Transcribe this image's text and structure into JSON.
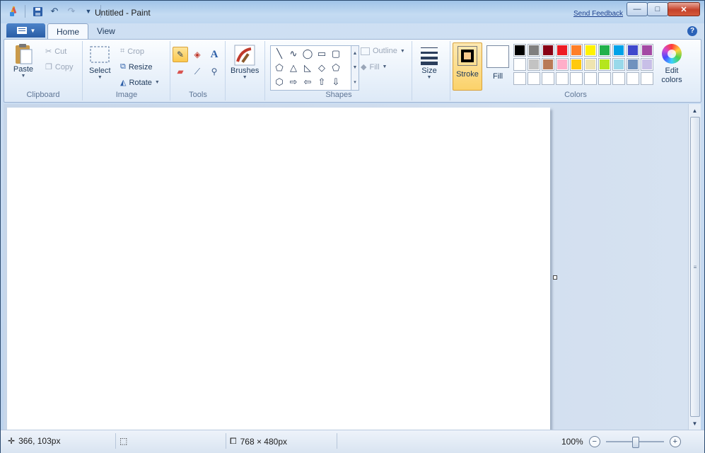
{
  "window": {
    "title": "Untitled - Paint",
    "feedback_link": "Send Feedback",
    "minimize_glyph": "—",
    "maximize_glyph": "□",
    "close_glyph": "✕"
  },
  "tabs": [
    {
      "label": "Home",
      "active": true
    },
    {
      "label": "View",
      "active": false
    }
  ],
  "help_glyph": "?",
  "ribbon": {
    "clipboard": {
      "group_label": "Clipboard",
      "paste": "Paste",
      "cut": "Cut",
      "copy": "Copy"
    },
    "image": {
      "group_label": "Image",
      "select": "Select",
      "crop": "Crop",
      "resize": "Resize",
      "rotate": "Rotate"
    },
    "tools": {
      "group_label": "Tools",
      "selected_tool": "pencil"
    },
    "brushes": {
      "label": "Brushes"
    },
    "shapes": {
      "group_label": "Shapes",
      "outline": "Outline",
      "fill": "Fill"
    },
    "size": {
      "label": "Size"
    },
    "colors": {
      "group_label": "Colors",
      "stroke_label": "Stroke",
      "fill_label": "Fill",
      "edit_colors_line1": "Edit",
      "edit_colors_line2": "colors",
      "stroke_color": "#000000",
      "fill_color": "#ffffff",
      "palette_row1": [
        "#000000",
        "#7f7f7f",
        "#880015",
        "#ed1c24",
        "#ff7f27",
        "#fff200",
        "#22b14c",
        "#00a2e8",
        "#3f48cc",
        "#a349a4"
      ],
      "palette_row2": [
        "#ffffff",
        "#c3c3c3",
        "#b97a57",
        "#ffaec9",
        "#ffc90e",
        "#efe4b0",
        "#b5e61d",
        "#99d9ea",
        "#7092be",
        "#c8bfe7"
      ],
      "palette_row3": [
        "#ffffff",
        "#ffffff",
        "#ffffff",
        "#ffffff",
        "#ffffff",
        "#ffffff",
        "#ffffff",
        "#ffffff",
        "#ffffff",
        "#ffffff"
      ]
    }
  },
  "status": {
    "cursor_position": "366, 103px",
    "canvas_size": "768 × 480px",
    "zoom": "100%",
    "zoom_fraction": 0.5
  }
}
